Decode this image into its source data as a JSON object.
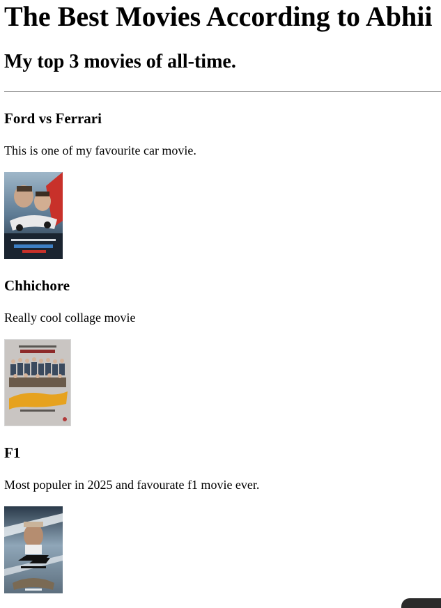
{
  "page": {
    "title": "The Best Movies According to Abhii",
    "subtitle": "My top 3 movies of all-time."
  },
  "movies": [
    {
      "name": "Ford vs Ferrari",
      "description": "This is one of my favourite car movie.",
      "poster_icon": "ford-vs-ferrari-poster"
    },
    {
      "name": "Chhichore",
      "description": "Really cool collage movie",
      "poster_icon": "chhichore-poster"
    },
    {
      "name": "F1",
      "description": "Most populer in 2025 and favourate f1 movie ever.",
      "poster_icon": "f1-poster"
    }
  ],
  "colors": {
    "text": "#000000",
    "background": "#ffffff",
    "divider": "#9a9a9a"
  }
}
